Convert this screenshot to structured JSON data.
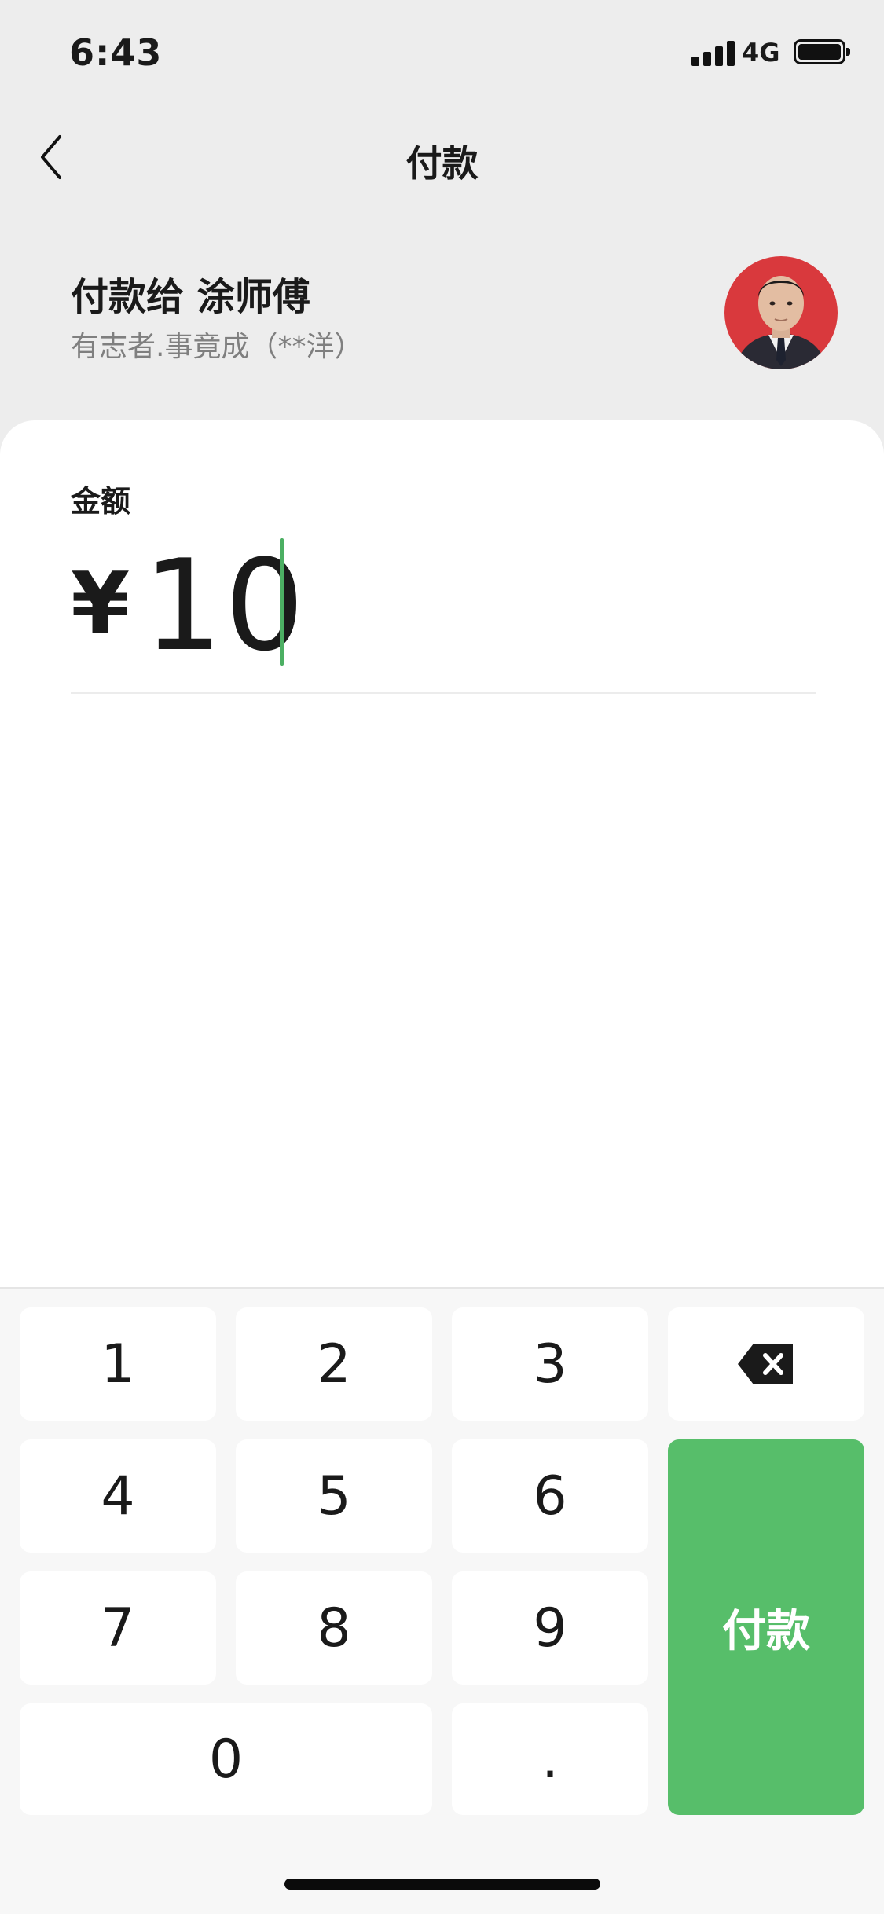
{
  "status_bar": {
    "time": "6:43",
    "network": "4G"
  },
  "nav": {
    "title": "付款"
  },
  "payee": {
    "title": "付款给 涂师傅",
    "subtitle": "有志者.事竟成（**洋）"
  },
  "amount": {
    "label": "金额",
    "currency": "¥",
    "value": "10"
  },
  "keypad": {
    "keys": [
      "1",
      "2",
      "3",
      "4",
      "5",
      "6",
      "7",
      "8",
      "9",
      "0",
      "."
    ],
    "pay_label": "付款",
    "accent_color": "#57be6a"
  },
  "icons": {
    "back": "chevron-left-icon",
    "backspace": "backspace-icon",
    "signal": "signal-icon",
    "battery": "battery-icon"
  }
}
